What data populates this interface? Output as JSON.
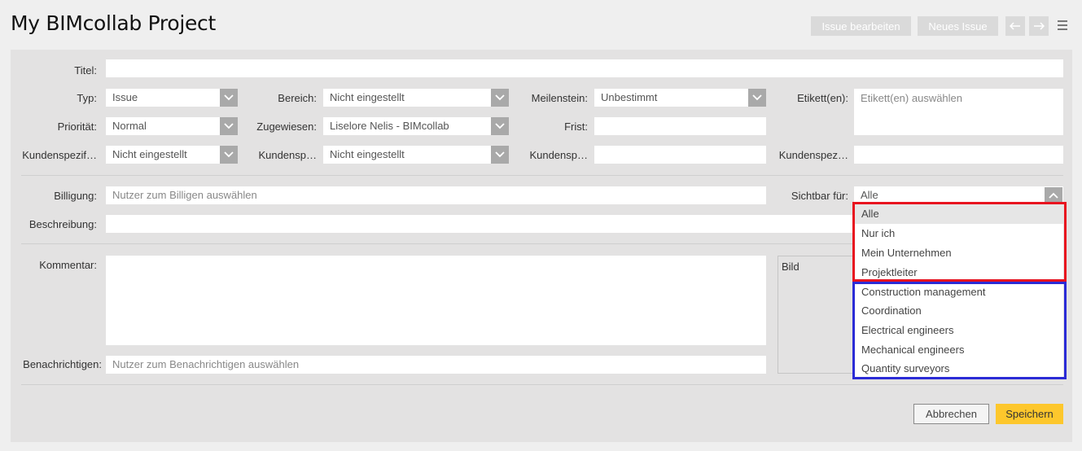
{
  "header": {
    "title": "My BIMcollab Project",
    "edit_issue_label": "Issue bearbeiten",
    "new_issue_label": "Neues Issue",
    "prev_icon": "arrow-left-icon",
    "next_icon": "arrow-right-icon",
    "menu_icon": "hamburger-menu-icon"
  },
  "form": {
    "title_label": "Titel:",
    "title_value": "",
    "type_label": "Typ:",
    "type_value": "Issue",
    "area_label": "Bereich:",
    "area_value": "Nicht eingestellt",
    "milestone_label": "Meilenstein:",
    "milestone_value": "Unbestimmt",
    "tags_label": "Etikett(en):",
    "tags_placeholder": "Etikett(en) auswählen",
    "priority_label": "Priorität:",
    "priority_value": "Normal",
    "assigned_label": "Zugewiesen:",
    "assigned_value": "Liselore Nelis - BIMcollab",
    "deadline_label": "Frist:",
    "deadline_value": "",
    "custom1_label": "Kundenspezif…",
    "custom1_value": "Nicht eingestellt",
    "custom2_label": "Kundensp…",
    "custom2_value": "Nicht eingestellt",
    "custom3_label": "Kundensp…",
    "custom3_value": "",
    "custom4_label": "Kundenspez…",
    "custom4_value": "",
    "approval_label": "Billigung:",
    "approval_placeholder": "Nutzer zum Billigen auswählen",
    "visible_label": "Sichtbar für:",
    "visible_value": "Alle",
    "description_label": "Beschreibung:",
    "comment_label": "Kommentar:",
    "image_label": "Bild",
    "notify_label": "Benachrichtigen:",
    "notify_placeholder": "Nutzer zum Benachrichtigen auswählen"
  },
  "dropdown": {
    "options": [
      "Alle",
      "Nur ich",
      "Mein Unternehmen",
      "Projektleiter",
      "Construction management",
      "Coordination",
      "Electrical engineers",
      "Mechanical engineers",
      "Quantity surveyors"
    ],
    "selected": "Alle",
    "highlight_red_color": "#e8141f",
    "highlight_blue_color": "#2b2bd6"
  },
  "footer": {
    "cancel_label": "Abbrechen",
    "save_label": "Speichern",
    "save_color": "#fdc72c"
  }
}
